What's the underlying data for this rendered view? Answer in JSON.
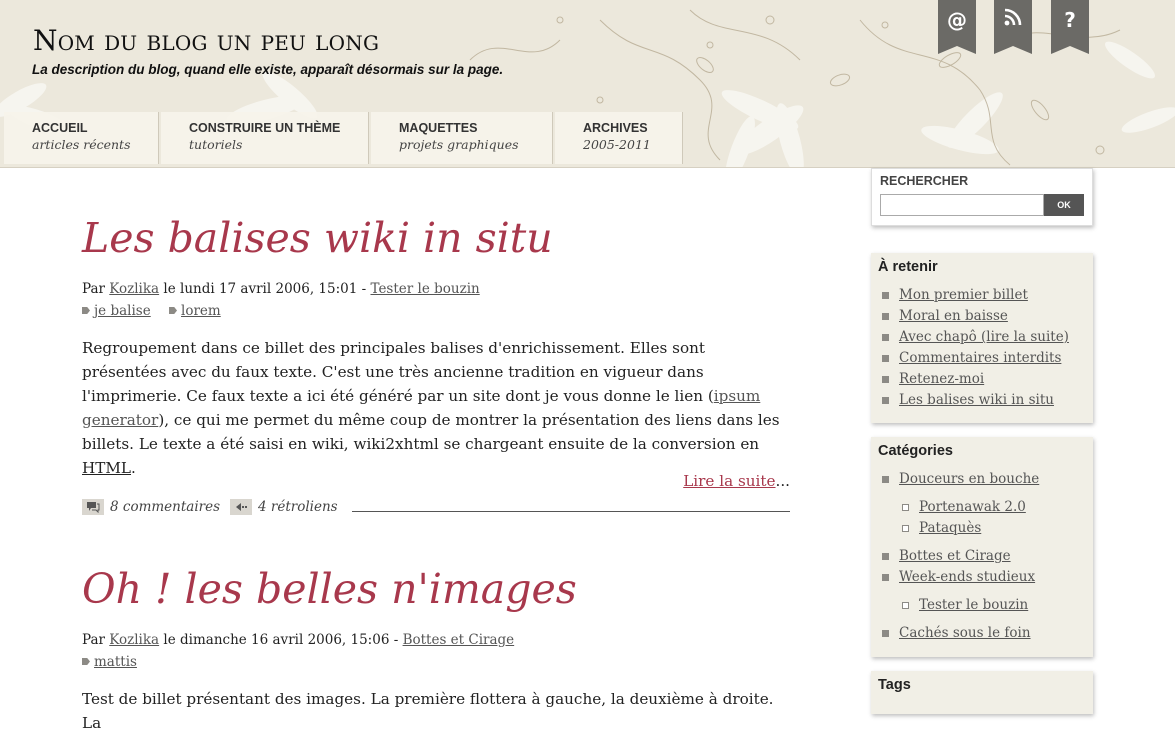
{
  "header": {
    "blog_title": "Nom du blog un peu long",
    "blog_description": "La description du blog, quand elle existe, apparaît désormais sur la page.",
    "icons": [
      {
        "name": "email",
        "glyph": "@"
      },
      {
        "name": "rss",
        "glyph": ""
      },
      {
        "name": "help",
        "glyph": "?"
      }
    ]
  },
  "nav": [
    {
      "title": "ACCUEIL",
      "subtitle": "articles récents"
    },
    {
      "title": "CONSTRUIRE UN THÈME",
      "subtitle": "tutoriels"
    },
    {
      "title": "MAQUETTES",
      "subtitle": "projets graphiques"
    },
    {
      "title": "ARCHIVES",
      "subtitle": "2005-2011"
    }
  ],
  "posts": [
    {
      "title": "Les balises wiki in situ",
      "by": "Par",
      "author": "Kozlika",
      "date": "le lundi 17 avril 2006, 15:01 -",
      "category": "Tester le bouzin",
      "tags": [
        "je balise",
        "lorem"
      ],
      "body_1": "Regroupement dans ce billet des principales balises d'enrichissement. Elles sont présentées avec du faux texte. C'est une très ancienne tradition en vigueur dans l'imprimerie. Ce faux texte a ici été généré par un site dont je vous donne le lien (",
      "body_link": "ipsum generator",
      "body_2": "), ce qui me permet du même coup de montrer la présentation des liens dans les billets. Le texte a été saisi en wiki, wiki2xhtml se chargeant ensuite de la conversion en ",
      "body_abbr": "HTML",
      "body_3": ".",
      "read_more": "Lire la suite",
      "read_more_suffix": "...",
      "comments": "8 commentaires",
      "trackbacks": "4 rétroliens"
    },
    {
      "title": "Oh ! les belles n'images",
      "by": "Par",
      "author": "Kozlika",
      "date": "le dimanche 16 avril 2006, 15:06 -",
      "category": "Bottes et Cirage",
      "tags": [
        "mattis"
      ],
      "body_1": "Test de billet présentant des images. La première flottera à gauche, la deuxième à droite. La"
    }
  ],
  "sidebar": {
    "search": {
      "title": "RECHERCHER",
      "button": "OK",
      "value": ""
    },
    "retenir": {
      "title": "À retenir",
      "items": [
        "Mon premier billet",
        "Moral en baisse",
        "Avec chapô (lire la suite)",
        "Commentaires interdits",
        "Retenez-moi",
        "Les balises wiki in situ"
      ]
    },
    "categories": {
      "title": "Catégories",
      "items": [
        "Douceurs en bouche",
        "Portenawak 2.0",
        "Pataquès",
        "Bottes et Cirage",
        "Week-ends studieux",
        "Tester le bouzin",
        "Cachés sous le foin"
      ]
    },
    "tags": {
      "title": "Tags"
    }
  }
}
